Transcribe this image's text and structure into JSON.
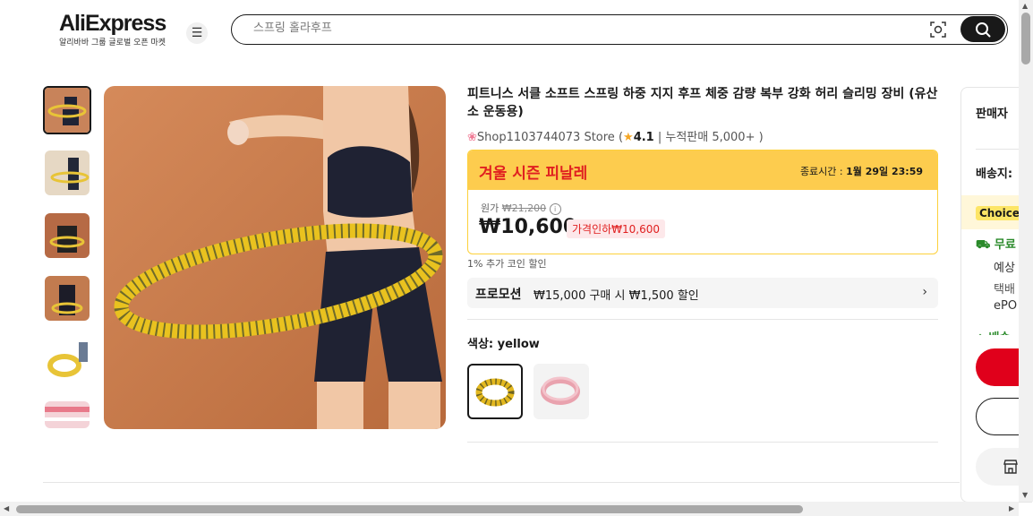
{
  "header": {
    "logo": "AliExpress",
    "logo_sub": "알리바바 그룹 글로벌 오픈 마켓",
    "search_placeholder": "스프링 홀라후프"
  },
  "product": {
    "title": "피트니스 서클 소프트 스프링 하중 지지 후프 체중 감량 복부 강화 허리 슬리밍 장비 (유산소 운동용)",
    "store_name": "Shop1103744073 Store",
    "rating": "4.1",
    "sold_text": "누적판매 5,000+",
    "sale": {
      "name": "겨울 시즌 피날레",
      "end_label": "종료시간 :",
      "end_time": "1월 29일 23:59",
      "orig_label": "원가",
      "orig_price": "₩21,200",
      "price": "₩10,600",
      "discount": "가격인하₩10,600"
    },
    "coin_text": "1% 추가 코인 할인",
    "promo": {
      "label": "프로모션",
      "text": "₩15,000 구매 시 ₩1,500 할인"
    },
    "color_label": "색상:",
    "color_value": "yellow"
  },
  "right_panel": {
    "seller": "판매자",
    "ship_to": "배송지:",
    "choice": "Choice",
    "free": "무료",
    "line1": "예상",
    "line2": "택배",
    "line3": "ePO",
    "line4": "배송"
  },
  "colors": {
    "accent": "#e02020",
    "sale_band": "#fdcc4e",
    "buy_button": "#e0001b"
  }
}
